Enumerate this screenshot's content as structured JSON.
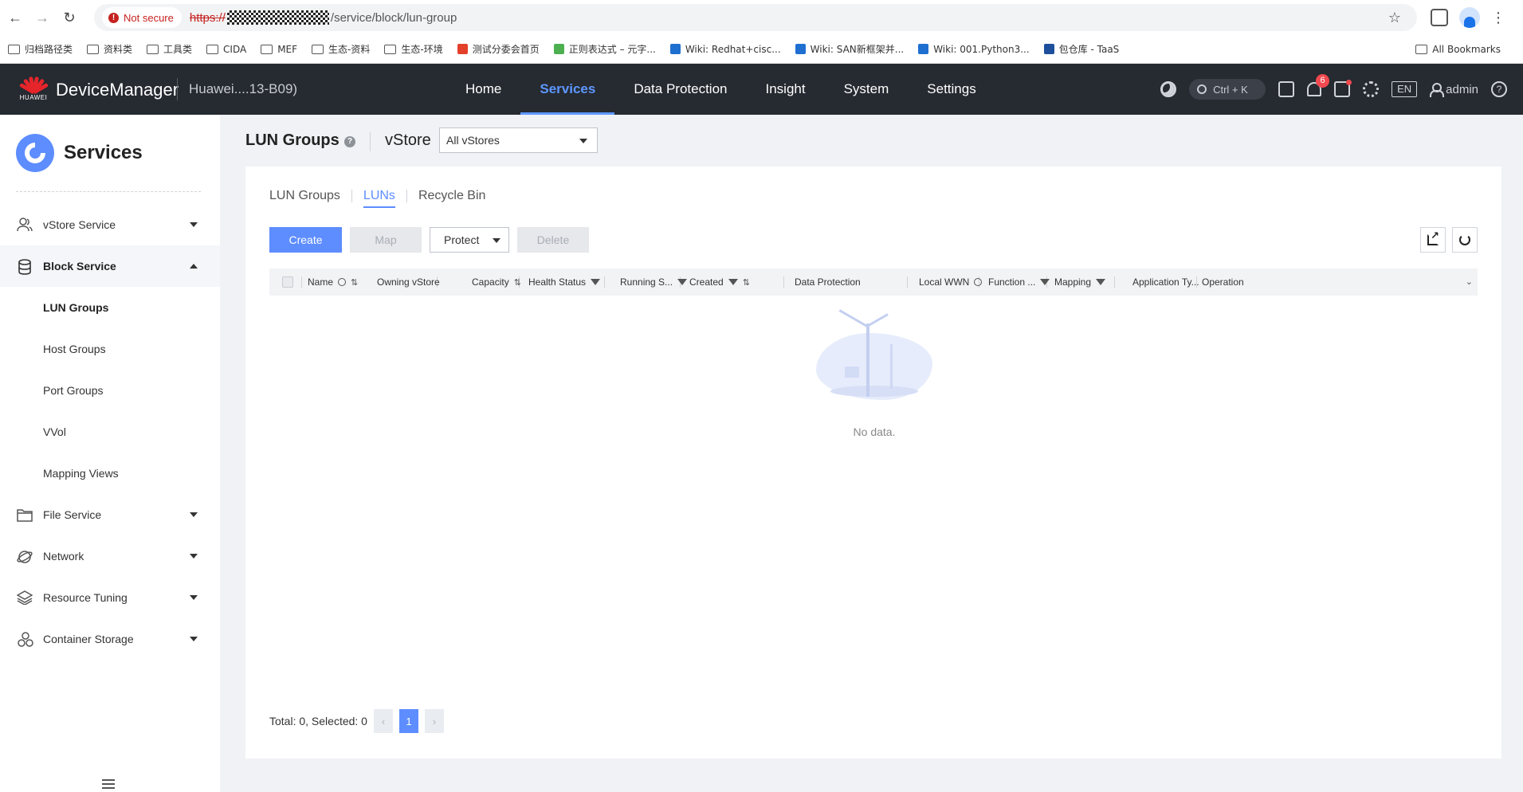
{
  "browser": {
    "security_label": "Not secure",
    "url_scheme": "https://",
    "url_path": "/service/block/lun-group",
    "bookmarks": [
      {
        "label": "归档路径类",
        "type": "folder"
      },
      {
        "label": "资料类",
        "type": "folder"
      },
      {
        "label": "工具类",
        "type": "folder"
      },
      {
        "label": "CIDA",
        "type": "folder"
      },
      {
        "label": "MEF",
        "type": "folder"
      },
      {
        "label": "生态-资料",
        "type": "folder"
      },
      {
        "label": "生态-环境",
        "type": "folder"
      },
      {
        "label": "测试分委会首页",
        "type": "site",
        "color": "#e3402b"
      },
      {
        "label": "正则表达式 – 元字...",
        "type": "site",
        "color": "#4caf50"
      },
      {
        "label": "Wiki: Redhat+cisc...",
        "type": "site",
        "color": "#1f6fd1"
      },
      {
        "label": "Wiki: SAN新框架并...",
        "type": "site",
        "color": "#1f6fd1"
      },
      {
        "label": "Wiki: 001.Python3...",
        "type": "site",
        "color": "#1f6fd1"
      },
      {
        "label": "包仓库 - TaaS",
        "type": "site",
        "color": "#1d4f9c"
      }
    ],
    "all_bookmarks": "All Bookmarks"
  },
  "header": {
    "logo_text": "HUAWEI",
    "brand": "DeviceManager",
    "device_name": "Huawei....13-B09)",
    "nav": [
      "Home",
      "Services",
      "Data Protection",
      "Insight",
      "System",
      "Settings"
    ],
    "active_nav": "Services",
    "search_shortcut": "Ctrl + K",
    "alarm_count": "6",
    "language": "EN",
    "user": "admin",
    "help": "?"
  },
  "sidebar": {
    "title": "Services",
    "items": [
      {
        "label": "vStore Service",
        "icon": "users-icon",
        "expanded": false
      },
      {
        "label": "Block Service",
        "icon": "database-icon",
        "expanded": true
      },
      {
        "label": "LUN Groups",
        "sub": true,
        "active": true
      },
      {
        "label": "Host Groups",
        "sub": true
      },
      {
        "label": "Port Groups",
        "sub": true
      },
      {
        "label": "VVol",
        "sub": true
      },
      {
        "label": "Mapping Views",
        "sub": true
      },
      {
        "label": "File Service",
        "icon": "folder-icon",
        "expanded": false
      },
      {
        "label": "Network",
        "icon": "globe-icon",
        "expanded": false
      },
      {
        "label": "Resource Tuning",
        "icon": "layers-icon",
        "expanded": false
      },
      {
        "label": "Container Storage",
        "icon": "hexagons-icon",
        "expanded": false
      }
    ]
  },
  "main": {
    "title": "LUN Groups",
    "help": "?",
    "vstore_label": "vStore",
    "vstore_value": "All vStores",
    "tabs": [
      "LUN Groups",
      "LUNs",
      "Recycle Bin"
    ],
    "active_tab": "LUNs",
    "buttons": {
      "create": "Create",
      "map": "Map",
      "protect": "Protect",
      "delete": "Delete"
    },
    "columns": [
      "Name",
      "Owning vStore",
      "Capacity",
      "Health Status",
      "Running S...",
      "Created",
      "Data Protection",
      "Local WWN",
      "Function ...",
      "Mapping",
      "Application Ty...",
      "Operation"
    ],
    "empty_text": "No data.",
    "pager": {
      "summary": "Total: 0, Selected: 0",
      "prev": "‹",
      "page": "1",
      "next": "›"
    }
  }
}
